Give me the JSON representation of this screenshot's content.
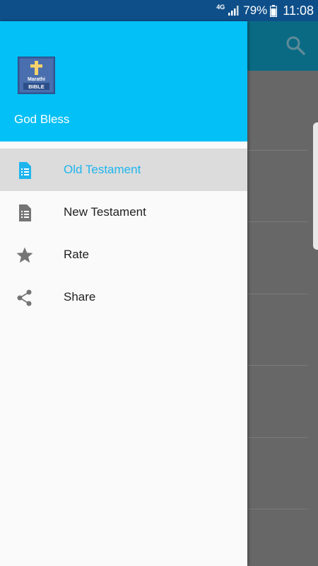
{
  "status_bar": {
    "network": "4G",
    "battery_percent": "79%",
    "time": "11:08"
  },
  "drawer": {
    "header": {
      "logo_text_top": "Marathi",
      "logo_text_bottom": "BIBLE",
      "title": "God Bless"
    },
    "items": [
      {
        "label": "Old Testament",
        "icon": "document-icon",
        "selected": true
      },
      {
        "label": "New Testament",
        "icon": "document-icon",
        "selected": false
      },
      {
        "label": "Rate",
        "icon": "star-icon",
        "selected": false
      },
      {
        "label": "Share",
        "icon": "share-icon",
        "selected": false
      }
    ]
  },
  "colors": {
    "status_bar": "#0e4f8a",
    "drawer_header": "#03c0f6",
    "selected_text": "#1eb5ee",
    "scrim": "#646464"
  }
}
